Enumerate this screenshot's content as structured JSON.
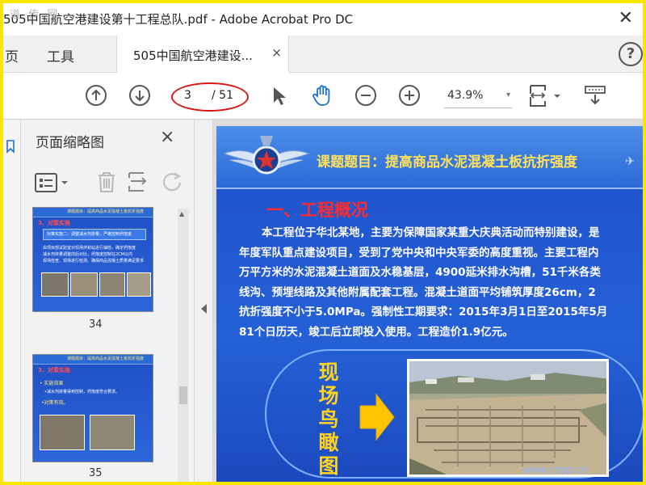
{
  "app": {
    "window_title": "505中国航空港建设第十工程总队.pdf - Adobe Acrobat Pro DC",
    "watermark": "道 传 网"
  },
  "tabs": {
    "home": "页",
    "tools": "工具",
    "document": "505中国航空港建设...",
    "close": "×",
    "help": "?"
  },
  "toolbar": {
    "page_current": "3",
    "page_total": "/ 51",
    "zoom": "43.9%"
  },
  "thumbnail_panel": {
    "title": "页面缩略图",
    "close": "×",
    "thumbnails": [
      {
        "page": "34",
        "header": "课题题目：提高商品水泥混凝土板抗折强度",
        "section": "3、对策实施",
        "subtitle": "对策实施二：调整减水剂掺量，严格控制坍落度",
        "lines": [
          "由项目部试验室对现场拌和站进行抽检，确定坍落度",
          "减水剂掺量调整前后对比，坍落度控制在2CM以内",
          "现场检查、现场进行检测、确保商品混凝土质量满足要求"
        ]
      },
      {
        "page": "35",
        "header": "课题题目：提高商品水泥混凝土板抗折强度",
        "section": "3、对策实施",
        "bullet1": "• 实施效果",
        "line1": "•减水剂掺量得到控制，坍落度符合要求。",
        "bullet2": "•对策有效。"
      }
    ]
  },
  "slide": {
    "title": "课题题目：提高商品水泥混凝土板抗折强度",
    "section": "一、工程概况",
    "body_lines": [
      "本工程位于华北某地，主要为保障国家某重大庆典活动而特别建设，是",
      "年度军队重点建设项目，受到了党中央和中央军委的高度重视。主要工程内",
      "万平方米的水泥混凝土道面及水稳基层，4900延米排水沟槽，51千米各类",
      "线沟、预埋线路及其他附属配套工程。混凝土道面平均铺筑厚度26cm，2",
      "抗折强度不小于5.0MPa。强制性工期要求：2015年3月1日至2015年5月",
      "81个日历天，竣工后立即投入使用。工程造价1.9亿元。"
    ],
    "vertical_label": [
      "现",
      "场",
      "鸟",
      "瞰",
      "图"
    ],
    "watermark": "www.cnpp.cn"
  },
  "colors": {
    "frame": "#f7e600",
    "slide_blue": "#2560d6",
    "slide_title": "#ffe25a",
    "section_red": "#ff2b2b",
    "annotation_ring": "#d41818"
  }
}
